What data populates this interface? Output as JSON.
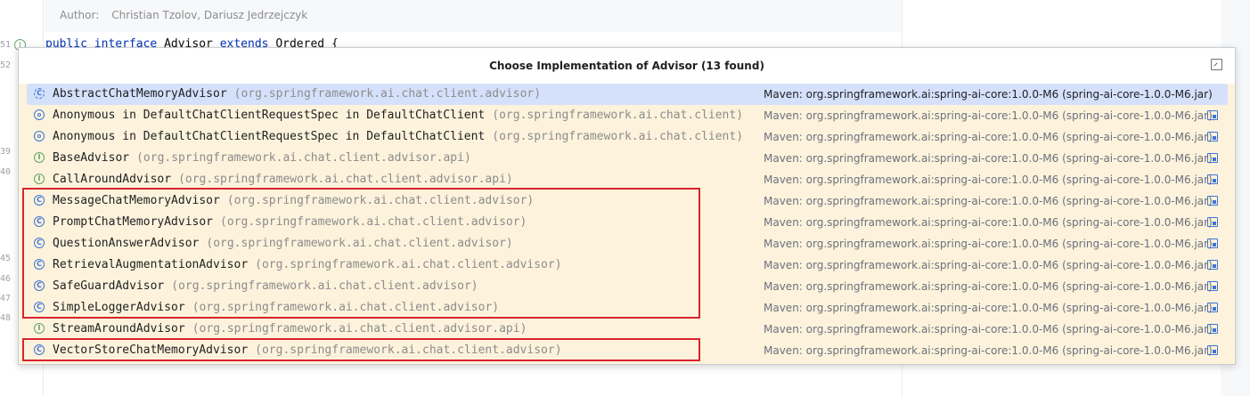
{
  "editor": {
    "author_label": "Author:",
    "author_value": "Christian Tzolov, Dariusz Jedrzejczyk",
    "code_line": {
      "kw1": "public",
      "kw2": "interface",
      "name": "Advisor",
      "kw3": "extends",
      "type": "Ordered",
      "brace": "{"
    },
    "line_numbers": [
      "51",
      "52",
      "39",
      "40",
      "45",
      "46",
      "47",
      "48"
    ]
  },
  "popup": {
    "title": "Choose Implementation of Advisor (13 found)",
    "pin_icon": "pin-window-icon",
    "rows": [
      {
        "icon": "abstract-class-icon",
        "kind": "abstract",
        "name": "AbstractChatMemoryAdvisor",
        "pkg": "(org.springframework.ai.chat.client.advisor)",
        "maven": "Maven: org.springframework.ai:spring-ai-core:1.0.0-M6 (spring-ai-core-1.0.0-M6.jar)",
        "selected": true
      },
      {
        "icon": "anonymous-class-icon",
        "kind": "anon",
        "name": "Anonymous in DefaultChatClientRequestSpec in DefaultChatClient",
        "pkg": "(org.springframework.ai.chat.client)",
        "maven": "Maven: org.springframework.ai:spring-ai-core:1.0.0-M6 (spring-ai-core-1.0.0-M6.jar)"
      },
      {
        "icon": "anonymous-class-icon",
        "kind": "anon",
        "name": "Anonymous in DefaultChatClientRequestSpec in DefaultChatClient",
        "pkg": "(org.springframework.ai.chat.client)",
        "maven": "Maven: org.springframework.ai:spring-ai-core:1.0.0-M6 (spring-ai-core-1.0.0-M6.jar)"
      },
      {
        "icon": "interface-icon",
        "kind": "interface",
        "name": "BaseAdvisor",
        "pkg": "(org.springframework.ai.chat.client.advisor.api)",
        "maven": "Maven: org.springframework.ai:spring-ai-core:1.0.0-M6 (spring-ai-core-1.0.0-M6.jar)"
      },
      {
        "icon": "interface-icon",
        "kind": "interface",
        "name": "CallAroundAdvisor",
        "pkg": "(org.springframework.ai.chat.client.advisor.api)",
        "maven": "Maven: org.springframework.ai:spring-ai-core:1.0.0-M6 (spring-ai-core-1.0.0-M6.jar)"
      },
      {
        "icon": "class-icon",
        "kind": "cls",
        "name": "MessageChatMemoryAdvisor",
        "pkg": "(org.springframework.ai.chat.client.advisor)",
        "maven": "Maven: org.springframework.ai:spring-ai-core:1.0.0-M6 (spring-ai-core-1.0.0-M6.jar)"
      },
      {
        "icon": "class-icon",
        "kind": "cls",
        "name": "PromptChatMemoryAdvisor",
        "pkg": "(org.springframework.ai.chat.client.advisor)",
        "maven": "Maven: org.springframework.ai:spring-ai-core:1.0.0-M6 (spring-ai-core-1.0.0-M6.jar)"
      },
      {
        "icon": "class-icon",
        "kind": "cls",
        "name": "QuestionAnswerAdvisor",
        "pkg": "(org.springframework.ai.chat.client.advisor)",
        "maven": "Maven: org.springframework.ai:spring-ai-core:1.0.0-M6 (spring-ai-core-1.0.0-M6.jar)"
      },
      {
        "icon": "class-icon",
        "kind": "cls",
        "name": "RetrievalAugmentationAdvisor",
        "pkg": "(org.springframework.ai.chat.client.advisor)",
        "maven": "Maven: org.springframework.ai:spring-ai-core:1.0.0-M6 (spring-ai-core-1.0.0-M6.jar)"
      },
      {
        "icon": "class-icon",
        "kind": "cls",
        "name": "SafeGuardAdvisor",
        "pkg": "(org.springframework.ai.chat.client.advisor)",
        "maven": "Maven: org.springframework.ai:spring-ai-core:1.0.0-M6 (spring-ai-core-1.0.0-M6.jar)"
      },
      {
        "icon": "class-icon",
        "kind": "cls",
        "name": "SimpleLoggerAdvisor",
        "pkg": "(org.springframework.ai.chat.client.advisor)",
        "maven": "Maven: org.springframework.ai:spring-ai-core:1.0.0-M6 (spring-ai-core-1.0.0-M6.jar)"
      },
      {
        "icon": "interface-icon",
        "kind": "interface",
        "name": "StreamAroundAdvisor",
        "pkg": "(org.springframework.ai.chat.client.advisor.api)",
        "maven": "Maven: org.springframework.ai:spring-ai-core:1.0.0-M6 (spring-ai-core-1.0.0-M6.jar)"
      },
      {
        "icon": "class-icon",
        "kind": "cls",
        "name": "VectorStoreChatMemoryAdvisor",
        "pkg": "(org.springframework.ai.chat.client.advisor)",
        "maven": "Maven: org.springframework.ai:spring-ai-core:1.0.0-M6 (spring-ai-core-1.0.0-M6.jar)"
      }
    ]
  },
  "colors": {
    "highlight_box": "#d9232d",
    "selection": "#d5e1fb",
    "popup_bg": "#fdf3dc"
  }
}
